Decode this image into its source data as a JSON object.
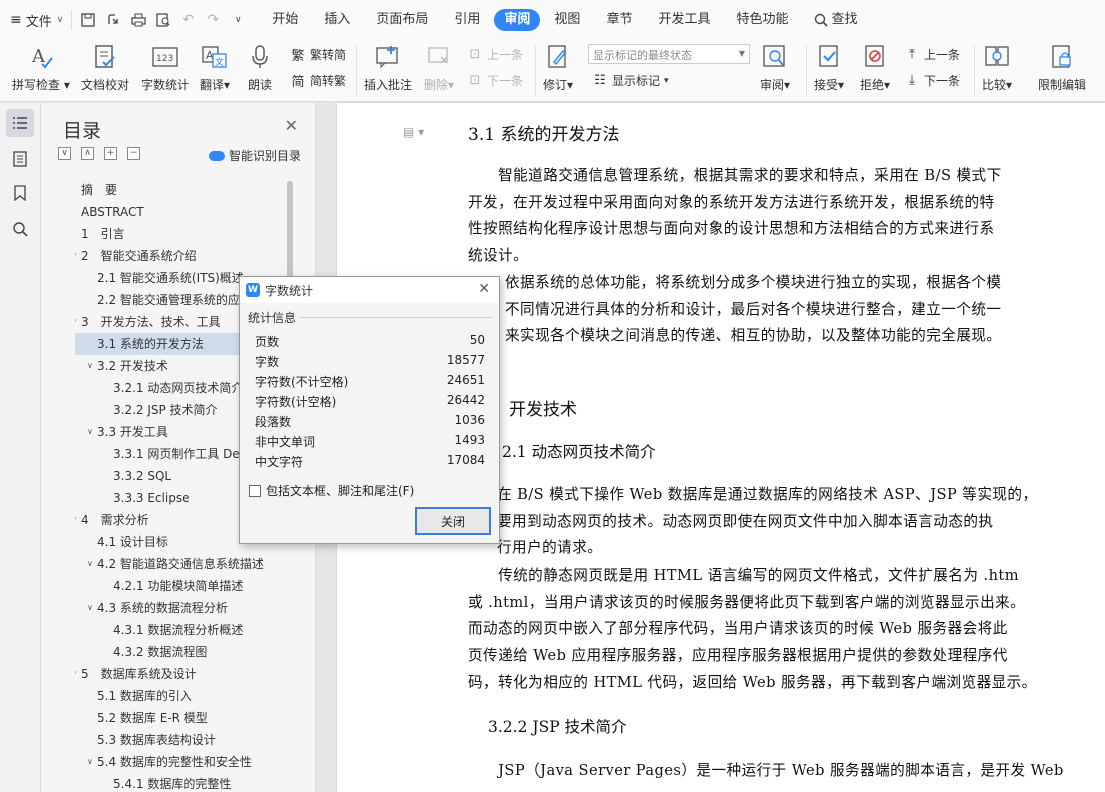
{
  "menubar": {
    "file_label": "文件",
    "tabs": [
      {
        "label": "开始"
      },
      {
        "label": "插入"
      },
      {
        "label": "页面布局"
      },
      {
        "label": "引用"
      },
      {
        "label": "审阅",
        "active": true
      },
      {
        "label": "视图"
      },
      {
        "label": "章节"
      },
      {
        "label": "开发工具"
      },
      {
        "label": "特色功能"
      },
      {
        "label": "查找"
      }
    ]
  },
  "ribbon": {
    "spell_check": "拼写检查",
    "doc_proof": "文档校对",
    "word_count": "字数统计",
    "translate": "翻译",
    "read_aloud": "朗读",
    "trad_to_simp": "繁转简",
    "simp_to_trad": "简转繁",
    "insert_comment": "插入批注",
    "delete": "删除",
    "prev_item": "上一条",
    "next_item": "下一条",
    "track_changes": "修订",
    "markup_state": "显示标记的最终状态",
    "show_markup": "显示标记",
    "review_pane": "审阅",
    "accept": "接受",
    "reject": "拒绝",
    "prev_change": "上一条",
    "next_change": "下一条",
    "compare": "比较",
    "restrict_edit": "限制编辑"
  },
  "toc": {
    "title": "目录",
    "smart_toc": "智能识别目录",
    "items": [
      {
        "text": "摘　要",
        "level": 0
      },
      {
        "text": "ABSTRACT",
        "level": 0
      },
      {
        "text": "1　引言",
        "level": 0
      },
      {
        "text": "2　智能交通系统介绍",
        "level": 0,
        "arrow": true
      },
      {
        "text": "2.1 智能交通系统(ITS)概述",
        "level": 1
      },
      {
        "text": "2.2 智能交通管理系统的应",
        "level": 1
      },
      {
        "text": "3　开发方法、技术、工具",
        "level": 0,
        "arrow": true
      },
      {
        "text": "3.1 系统的开发方法",
        "level": 1,
        "selected": true
      },
      {
        "text": "3.2 开发技术",
        "level": 1,
        "arrow": true
      },
      {
        "text": "3.2.1 动态网页技术简介",
        "level": 2
      },
      {
        "text": "3.2.2 JSP 技术简介",
        "level": 2
      },
      {
        "text": "3.3 开发工具",
        "level": 1,
        "arrow": true
      },
      {
        "text": "3.3.1 网页制作工具 Dea",
        "level": 2
      },
      {
        "text": "3.3.2 SQL",
        "level": 2
      },
      {
        "text": "3.3.3 Eclipse",
        "level": 2
      },
      {
        "text": "4　需求分析",
        "level": 0,
        "arrow": true
      },
      {
        "text": "4.1 设计目标",
        "level": 1
      },
      {
        "text": "4.2 智能道路交通信息系统描述",
        "level": 1,
        "arrow": true
      },
      {
        "text": "4.2.1 功能模块简单描述",
        "level": 2
      },
      {
        "text": "4.3 系统的数据流程分析",
        "level": 1,
        "arrow": true
      },
      {
        "text": "4.3.1 数据流程分析概述",
        "level": 2
      },
      {
        "text": "4.3.2 数据流程图",
        "level": 2
      },
      {
        "text": "5　数据库系统及设计",
        "level": 0,
        "arrow": true
      },
      {
        "text": "5.1 数据库的引入",
        "level": 1
      },
      {
        "text": "5.2 数据库 E-R 模型",
        "level": 1
      },
      {
        "text": "5.3 数据库表结构设计",
        "level": 1
      },
      {
        "text": "5.4 数据库的完整性和安全性",
        "level": 1,
        "arrow": true
      },
      {
        "text": "5.4.1 数据库的完整性",
        "level": 2
      }
    ]
  },
  "document": {
    "h_31": "3.1  系统的开发方法",
    "p1": [
      "　　智能道路交通信息管理系统，根据其需求的要求和特点，采用在 B/S 模式下",
      "开发，在开发过程中采用面向对象的系统开发方法进行系统开发，根据系统的特",
      "性按照结构化程序设计思想与面向对象的设计思想和方法相结合的方式来进行系",
      "统设计。"
    ],
    "p2": [
      "依据系统的总体功能，将系统划分成多个模块进行独立的实现，根据各个模",
      "不同情况进行具体的分析和设计，最后对各个模块进行整合，建立一个统一",
      "来实现各个模块之间消息的传递、相互的协助，以及整体功能的完全展现。"
    ],
    "h_32": "开发技术",
    "h_321": "2.1 动态网页技术简介",
    "p3": [
      "在 B/S 模式下操作 Web 数据库是通过数据库的网络技术 ASP、JSP 等实现的，",
      "要用到动态网页的技术。动态网页即使在网页文件中加入脚本语言动态的执",
      "行用户的请求。"
    ],
    "p4": [
      "　　传统的静态网页既是用 HTML 语言编写的网页文件格式，文件扩展名为 .htm",
      "或 .html，当用户请求该页的时候服务器便将此页下载到客户端的浏览器显示出来。",
      "而动态的网页中嵌入了部分程序代码，当用户请求该页的时候 Web 服务器会将此",
      "页传递给 Web 应用程序服务器，应用程序服务器根据用户提供的参数处理程序代",
      "码，转化为相应的 HTML 代码，返回给 Web 服务器，再下载到客户端浏览器显示。"
    ],
    "h_322": "3.2.2  JSP 技术简介",
    "p5": "　　JSP（Java Server Pages）是一种运行于 Web 服务器端的脚本语言，是开发 Web"
  },
  "dialog": {
    "title": "字数统计",
    "group_label": "统计信息",
    "stats": [
      {
        "key": "页数",
        "value": "50"
      },
      {
        "key": "字数",
        "value": "18577"
      },
      {
        "key": "字符数(不计空格)",
        "value": "24651"
      },
      {
        "key": "字符数(计空格)",
        "value": "26442"
      },
      {
        "key": "段落数",
        "value": "1036"
      },
      {
        "key": "非中文单词",
        "value": "1493"
      },
      {
        "key": "中文字符",
        "value": "17084"
      }
    ],
    "checkbox_label": "包括文本框、脚注和尾注(F)",
    "close_button": "关闭"
  },
  "colors": {
    "accent": "#2f86f6",
    "toc_selected": "#cfdcec"
  }
}
